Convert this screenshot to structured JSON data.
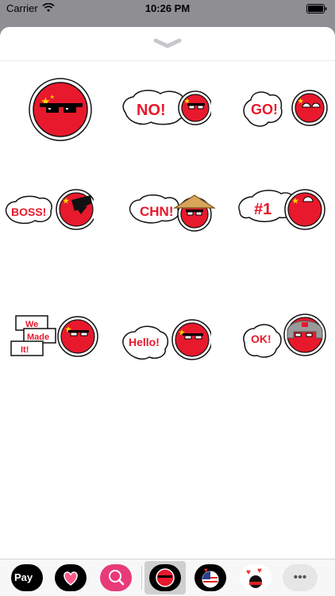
{
  "status": {
    "carrier": "Carrier",
    "time": "10:26 PM"
  },
  "stickers": [
    {
      "name": "sticker-sunglasses",
      "bubble": ""
    },
    {
      "name": "sticker-no",
      "bubble": "NO!"
    },
    {
      "name": "sticker-go",
      "bubble": "GO!"
    },
    {
      "name": "sticker-boss",
      "bubble": "BOSS!"
    },
    {
      "name": "sticker-chn",
      "bubble": "CHN!"
    },
    {
      "name": "sticker-number-one",
      "bubble": "#1"
    },
    {
      "name": "sticker-we-made-it",
      "lines": [
        "We",
        "Made",
        "It!"
      ]
    },
    {
      "name": "sticker-hello",
      "bubble": "Hello!"
    },
    {
      "name": "sticker-ok",
      "bubble": "OK!"
    }
  ],
  "app_drawer": {
    "apple_pay_label": "Pay",
    "more_label": "•••",
    "apps": [
      "apple-pay",
      "heart-app",
      "search-app",
      "current-sticker-pack",
      "usa-sticker-app",
      "love-sticker-app",
      "more"
    ]
  },
  "colors": {
    "flag_red": "#e8192c",
    "flag_yellow": "#ffd700",
    "bubble_text_red": "#e8192c",
    "selected_tab": "#cfcfcf",
    "search_app_pink": "#e83a78"
  }
}
